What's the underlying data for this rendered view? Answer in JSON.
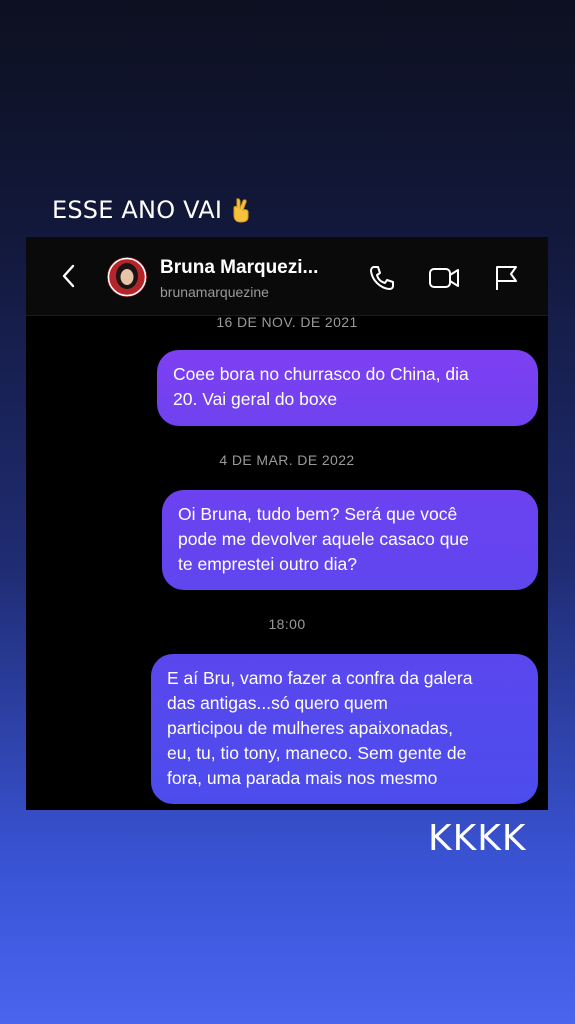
{
  "story": {
    "caption": "ESSE ANO VAI",
    "caption_emoji": "crossed-fingers-icon",
    "reaction": "KKKK"
  },
  "chat_header": {
    "contact_name": "Bruna Marquezi...",
    "contact_username": "brunamarquezine",
    "icons": [
      "back-icon",
      "phone-icon",
      "video-call-icon",
      "flag-icon"
    ]
  },
  "messages": [
    {
      "date": "16 DE NOV. DE 2021",
      "lines": [
        "Coee bora no churrasco do China, dia",
        "20. Vai geral do boxe"
      ]
    },
    {
      "date": "4 DE MAR. DE 2022",
      "lines": [
        "Oi Bruna, tudo bem? Será que você",
        "pode me devolver aquele casaco que",
        "te emprestei outro dia?"
      ]
    },
    {
      "date": "18:00",
      "lines": [
        "E aí Bru, vamo fazer a confra da galera",
        "das antigas...só quero quem",
        "participou de mulheres apaixonadas,",
        "eu, tu, tio tony, maneco. Sem gente de",
        "fora, uma parada mais nos mesmo"
      ]
    }
  ],
  "colors": {
    "bubble_top": "#7d3ff2",
    "bubble_bottom": "#4c4cec",
    "chat_background": "#000000"
  }
}
